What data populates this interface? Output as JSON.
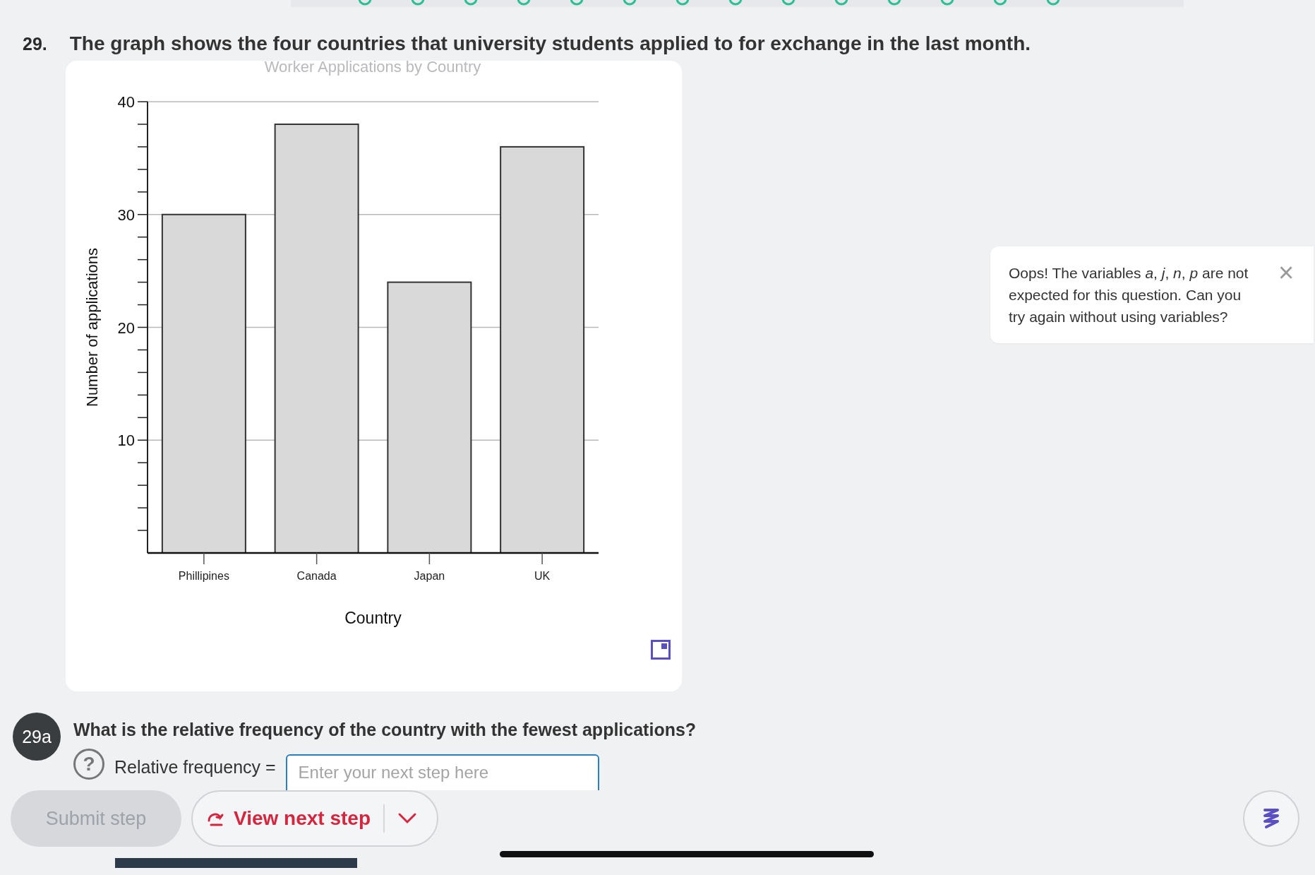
{
  "question": {
    "number": "29.",
    "text": "The graph shows the four countries that university students applied to for exchange in the last month.",
    "chart_data": {
      "type": "bar",
      "title": "Worker Applications by Country",
      "xlabel": "Country",
      "ylabel": "Number of applications",
      "categories": [
        "Phillipines",
        "Canada",
        "Japan",
        "UK"
      ],
      "values": [
        30,
        38,
        24,
        36
      ],
      "ylim": [
        0,
        40
      ],
      "yticks": [
        10,
        20,
        30,
        40
      ],
      "grid": true
    }
  },
  "hint": {
    "text": "Oops! The variables *a*, *j*, *n*, *p* are not expected for this question. Can you try again without using variables?",
    "close": "×"
  },
  "part": {
    "badge": "29a",
    "text": "What is the relative frequency of the country with the fewest applications?",
    "help": "?",
    "label": "Relative frequency =",
    "placeholder": "Enter your next step here"
  },
  "buttons": [
    {
      "kind": "submit",
      "label": "Submit step",
      "disabled": true
    },
    {
      "kind": "next",
      "label": "View next step",
      "disabled": false
    }
  ]
}
